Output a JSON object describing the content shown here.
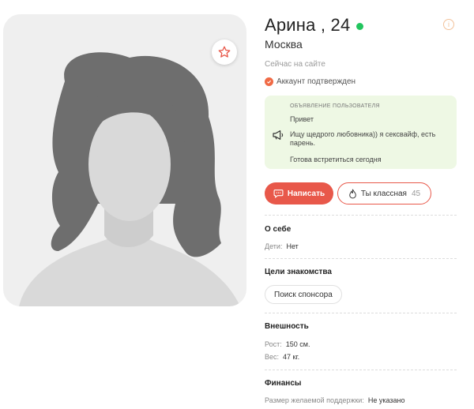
{
  "profile": {
    "name": "Арина , 24",
    "city": "Москва",
    "status": "Сейчас на сайте",
    "verified": "Аккаунт подтвержден",
    "online_color": "#22c55e"
  },
  "ad": {
    "title": "объявление пользователя",
    "greeting": "Привет",
    "text": "Ищу щедрого любовника)) я сексвайф, есть парень.",
    "footer": "Готова встретиться сегодня"
  },
  "actions": {
    "write_label": "Написать",
    "like_label": "Ты классная",
    "like_count": "45",
    "accent_color": "#e8584a"
  },
  "about": {
    "title": "О себе",
    "children_label": "Дети:",
    "children_value": "Нет"
  },
  "goals": {
    "title": "Цели знакомства",
    "chip": "Поиск спонсора"
  },
  "appearance": {
    "title": "Внешность",
    "height_label": "Рост:",
    "height_value": "150 см.",
    "weight_label": "Вес:",
    "weight_value": "47 кг."
  },
  "finance": {
    "title": "Финансы",
    "support_label": "Размер желаемой поддержки:",
    "support_value": "Не указано"
  },
  "icons": {
    "favorite": "star-icon",
    "info": "info-icon",
    "verified": "check-circle-icon",
    "ad": "megaphone-icon",
    "write": "chat-bubble-icon",
    "like": "flame-icon"
  }
}
